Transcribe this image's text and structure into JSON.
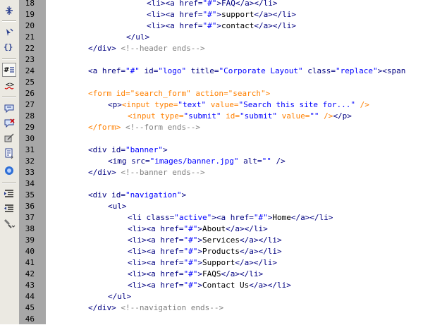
{
  "toolbar": {
    "tools": [
      {
        "icon": "collapse-full-tag-icon"
      },
      {
        "icon": "select-parent-tag-icon"
      },
      {
        "icon": "balance-braces-icon"
      },
      {
        "icon": "line-numbers-icon",
        "active": true
      },
      {
        "icon": "highlight-invalid-code-icon"
      },
      {
        "icon": "apply-comment-icon"
      },
      {
        "icon": "remove-comment-icon"
      },
      {
        "icon": "wrap-tag-icon"
      },
      {
        "icon": "recent-snippets-icon"
      },
      {
        "icon": "move-css-icon"
      },
      {
        "icon": "indent-code-icon"
      },
      {
        "icon": "outdent-code-icon"
      },
      {
        "icon": "format-source-code-icon"
      }
    ],
    "colors": {
      "background": "#ebe9e2",
      "gutter": "#a7a7a7"
    }
  },
  "editor": {
    "colors": {
      "tag": "#000080",
      "value": "#0000ff",
      "comment": "#808080",
      "form": "#ff8000",
      "text": "#000000"
    },
    "lines": [
      {
        "num": "18",
        "segs": [
          {
            "t": "<li><a href=",
            "k": "tag"
          },
          {
            "t": "\"#\"",
            "k": "val"
          },
          {
            "t": ">FAQ</a></li>",
            "k": "tag"
          }
        ]
      },
      {
        "num": "19",
        "segs": [
          {
            "t": "<li><a href=",
            "k": "tag"
          },
          {
            "t": "\"#\"",
            "k": "val"
          },
          {
            "t": ">",
            "k": "tag"
          },
          {
            "t": "support",
            "k": "text"
          },
          {
            "t": "</a></li>",
            "k": "tag"
          }
        ]
      },
      {
        "num": "20",
        "segs": [
          {
            "t": "<li><a href=",
            "k": "tag"
          },
          {
            "t": "\"#\"",
            "k": "val"
          },
          {
            "t": ">",
            "k": "tag"
          },
          {
            "t": "contact",
            "k": "text"
          },
          {
            "t": "</a></li>",
            "k": "tag"
          }
        ]
      },
      {
        "num": "21",
        "segs": [
          {
            "t": "</ul>",
            "k": "tag"
          }
        ]
      },
      {
        "num": "22",
        "segs": [
          {
            "t": "</div>",
            "k": "tag"
          },
          {
            "t": " <!--header ends-->",
            "k": "cmt"
          }
        ]
      },
      {
        "num": "23",
        "segs": []
      },
      {
        "num": "24",
        "segs": [
          {
            "t": "<a href=",
            "k": "tag"
          },
          {
            "t": "\"#\"",
            "k": "val"
          },
          {
            "t": " id=",
            "k": "tag"
          },
          {
            "t": "\"logo\"",
            "k": "val"
          },
          {
            "t": " title=",
            "k": "tag"
          },
          {
            "t": "\"Corporate Layout\"",
            "k": "val"
          },
          {
            "t": " class=",
            "k": "tag"
          },
          {
            "t": "\"replace\"",
            "k": "val"
          },
          {
            "t": "><span",
            "k": "tag"
          }
        ]
      },
      {
        "num": "25",
        "segs": []
      },
      {
        "num": "26",
        "segs": [
          {
            "t": "<form id=\"search_form\" action=\"search\">",
            "k": "form"
          }
        ]
      },
      {
        "num": "27",
        "segs": [
          {
            "t": "<p>",
            "k": "tag"
          },
          {
            "t": "<input type=",
            "k": "form"
          },
          {
            "t": "\"text\"",
            "k": "val"
          },
          {
            "t": " value=",
            "k": "form"
          },
          {
            "t": "\"Search this site for...\"",
            "k": "val"
          },
          {
            "t": " />",
            "k": "form"
          }
        ]
      },
      {
        "num": "28",
        "segs": [
          {
            "t": "<input type=",
            "k": "form"
          },
          {
            "t": "\"submit\"",
            "k": "val"
          },
          {
            "t": " id=",
            "k": "form"
          },
          {
            "t": "\"submit\"",
            "k": "val"
          },
          {
            "t": " value=",
            "k": "form"
          },
          {
            "t": "\"\"",
            "k": "val"
          },
          {
            "t": " />",
            "k": "form"
          },
          {
            "t": "</p>",
            "k": "tag"
          }
        ]
      },
      {
        "num": "29",
        "segs": [
          {
            "t": "</form>",
            "k": "form"
          },
          {
            "t": " <!--form ends-->",
            "k": "cmt"
          }
        ]
      },
      {
        "num": "30",
        "segs": []
      },
      {
        "num": "31",
        "segs": [
          {
            "t": "<div id=",
            "k": "tag"
          },
          {
            "t": "\"banner\"",
            "k": "val"
          },
          {
            "t": ">",
            "k": "tag"
          }
        ]
      },
      {
        "num": "32",
        "segs": [
          {
            "t": "<img src=",
            "k": "tag"
          },
          {
            "t": "\"images/banner.jpg\"",
            "k": "val"
          },
          {
            "t": " alt=",
            "k": "tag"
          },
          {
            "t": "\"\"",
            "k": "val"
          },
          {
            "t": " />",
            "k": "tag"
          }
        ]
      },
      {
        "num": "33",
        "segs": [
          {
            "t": "</div>",
            "k": "tag"
          },
          {
            "t": " <!--banner ends-->",
            "k": "cmt"
          }
        ]
      },
      {
        "num": "34",
        "segs": []
      },
      {
        "num": "35",
        "segs": [
          {
            "t": "<div id=",
            "k": "tag"
          },
          {
            "t": "\"navigation\"",
            "k": "val"
          },
          {
            "t": ">",
            "k": "tag"
          }
        ]
      },
      {
        "num": "36",
        "segs": [
          {
            "t": "<ul>",
            "k": "tag"
          }
        ]
      },
      {
        "num": "37",
        "segs": [
          {
            "t": "<li class=",
            "k": "tag"
          },
          {
            "t": "\"active\"",
            "k": "val"
          },
          {
            "t": "><a href=",
            "k": "tag"
          },
          {
            "t": "\"#\"",
            "k": "val"
          },
          {
            "t": ">",
            "k": "tag"
          },
          {
            "t": "Home",
            "k": "text"
          },
          {
            "t": "</a></li>",
            "k": "tag"
          }
        ]
      },
      {
        "num": "38",
        "segs": [
          {
            "t": "<li><a href=",
            "k": "tag"
          },
          {
            "t": "\"#\"",
            "k": "val"
          },
          {
            "t": ">",
            "k": "tag"
          },
          {
            "t": "About",
            "k": "text"
          },
          {
            "t": "</a></li>",
            "k": "tag"
          }
        ]
      },
      {
        "num": "39",
        "segs": [
          {
            "t": "<li><a href=",
            "k": "tag"
          },
          {
            "t": "\"#\"",
            "k": "val"
          },
          {
            "t": ">",
            "k": "tag"
          },
          {
            "t": "Services",
            "k": "text"
          },
          {
            "t": "</a></li>",
            "k": "tag"
          }
        ]
      },
      {
        "num": "40",
        "segs": [
          {
            "t": "<li><a href=",
            "k": "tag"
          },
          {
            "t": "\"#\"",
            "k": "val"
          },
          {
            "t": ">",
            "k": "tag"
          },
          {
            "t": "Products",
            "k": "text"
          },
          {
            "t": "</a></li>",
            "k": "tag"
          }
        ]
      },
      {
        "num": "41",
        "segs": [
          {
            "t": "<li><a href=",
            "k": "tag"
          },
          {
            "t": "\"#\"",
            "k": "val"
          },
          {
            "t": ">",
            "k": "tag"
          },
          {
            "t": "Support",
            "k": "text"
          },
          {
            "t": "</a></li>",
            "k": "tag"
          }
        ]
      },
      {
        "num": "42",
        "segs": [
          {
            "t": "<li><a href=",
            "k": "tag"
          },
          {
            "t": "\"#\"",
            "k": "val"
          },
          {
            "t": ">",
            "k": "tag"
          },
          {
            "t": "FAQS",
            "k": "text"
          },
          {
            "t": "</a></li>",
            "k": "tag"
          }
        ]
      },
      {
        "num": "43",
        "segs": [
          {
            "t": "<li><a href=",
            "k": "tag"
          },
          {
            "t": "\"#\"",
            "k": "val"
          },
          {
            "t": ">",
            "k": "tag"
          },
          {
            "t": "Contact Us",
            "k": "text"
          },
          {
            "t": "</a></li>",
            "k": "tag"
          }
        ]
      },
      {
        "num": "44",
        "segs": [
          {
            "t": "</ul>",
            "k": "tag"
          }
        ]
      },
      {
        "num": "45",
        "segs": [
          {
            "t": "</div>",
            "k": "tag"
          },
          {
            "t": " <!--navigation ends-->",
            "k": "cmt"
          }
        ]
      },
      {
        "num": "46",
        "segs": []
      }
    ]
  }
}
